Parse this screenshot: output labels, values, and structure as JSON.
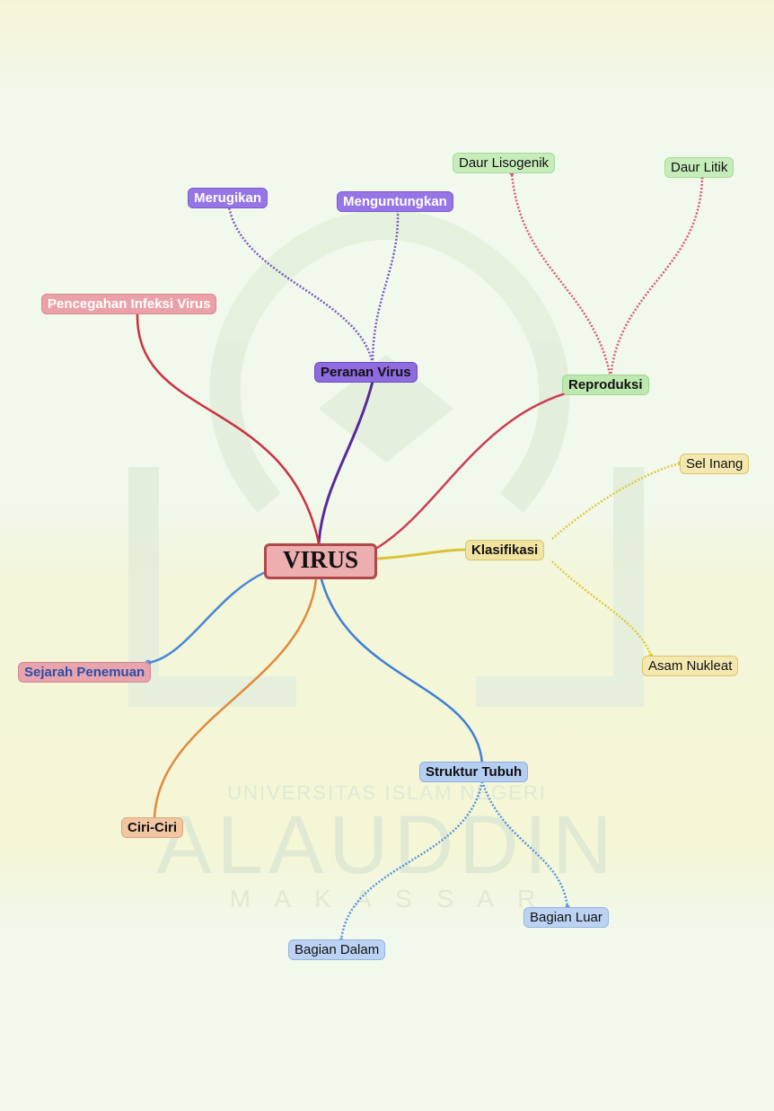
{
  "watermark": {
    "line1": "UNIVERSITAS ISLAM NEGERI",
    "line2": "ALAUDDIN",
    "line3": "M A K A S S A R"
  },
  "mindmap": {
    "root": "VIRUS",
    "nodes": {
      "peranan": "Peranan Virus",
      "merugikan": "Merugikan",
      "menguntungkan": "Menguntungkan",
      "pencegahan": "Pencegahan Infeksi Virus",
      "reproduksi": "Reproduksi",
      "daur_lisogenik": "Daur Lisogenik",
      "daur_litik": "Daur Litik",
      "klasifikasi": "Klasifikasi",
      "sel_inang": "Sel Inang",
      "asam_nukleat": "Asam Nukleat",
      "sejarah": "Sejarah Penemuan",
      "ciri": "Ciri-Ciri",
      "struktur": "Struktur Tubuh",
      "bagian_dalam": "Bagian Dalam",
      "bagian_luar": "Bagian Luar"
    }
  },
  "colors": {
    "purple": "#7a4fd9",
    "pink": "#e8959f",
    "red": "#d2405a",
    "green": "#bde8b0",
    "yellow": "#eed96a",
    "blue": "#4a86d8",
    "orange": "#e08a3c"
  }
}
